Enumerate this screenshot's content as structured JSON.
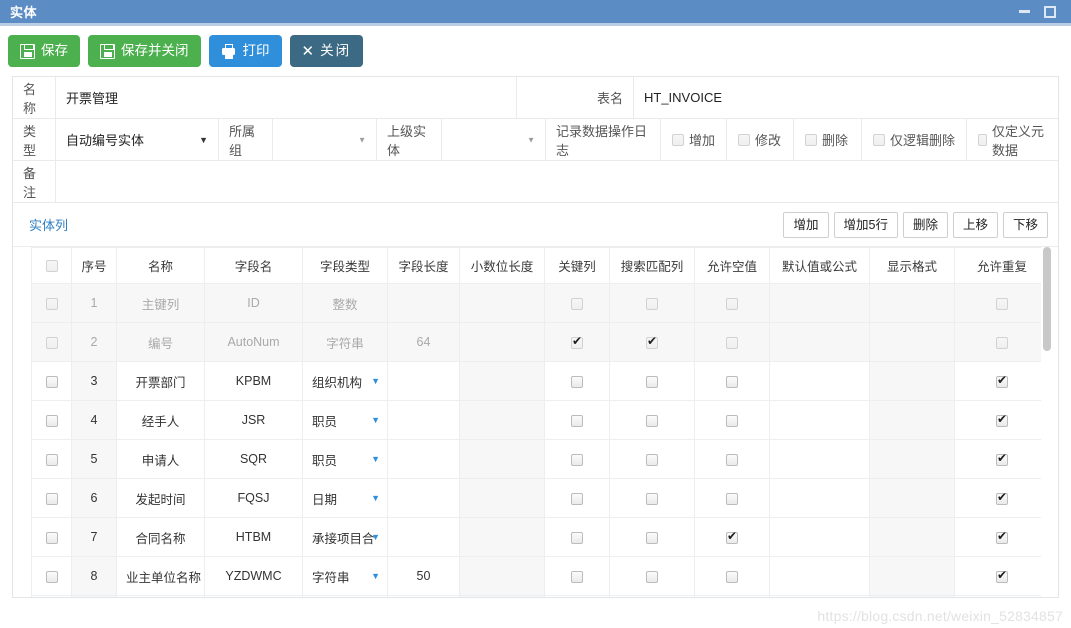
{
  "window": {
    "title": "实体",
    "minimize_label": "minimize",
    "maximize_label": "maximize",
    "accent_color": "#5b8cc4"
  },
  "toolbar": {
    "buttons": [
      {
        "label": "保存",
        "icon": "save-icon",
        "color": "#4cb04f"
      },
      {
        "label": "保存并关闭",
        "icon": "save-icon",
        "color": "#4cb04f"
      },
      {
        "label": "打印",
        "icon": "print-icon",
        "color": "#2f8fdb"
      },
      {
        "label": "关闭",
        "icon": "close-x-icon",
        "color": "#3c6a84"
      }
    ]
  },
  "form": {
    "name_label": "名称",
    "name_value": "开票管理",
    "table_label": "表名",
    "table_value": "HT_INVOICE",
    "type_label": "类型",
    "type_value": "自动编号实体",
    "group_label": "所属组",
    "group_value": "",
    "parent_label": "上级实体",
    "parent_value": "",
    "log_label": "记录数据操作日志",
    "log_options": [
      {
        "label": "增加",
        "checked": false
      },
      {
        "label": "修改",
        "checked": false
      },
      {
        "label": "删除",
        "checked": false
      },
      {
        "label": "仅逻辑删除",
        "checked": false
      },
      {
        "label": "仅定义元数据",
        "checked": false
      }
    ],
    "remark_label": "备注",
    "remark_value": ""
  },
  "grid": {
    "section_title": "实体列",
    "buttons": [
      "增加",
      "增加5行",
      "删除",
      "上移",
      "下移"
    ],
    "columns": [
      "",
      "序号",
      "名称",
      "字段名",
      "字段类型",
      "字段长度",
      "小数位长度",
      "关键列",
      "搜索匹配列",
      "允许空值",
      "默认值或公式",
      "显示格式",
      "允许重复"
    ],
    "rows": [
      {
        "seq": "1",
        "name": "主键列",
        "field": "ID",
        "type": "整数",
        "type_dropdown": false,
        "length": "",
        "decimals": "",
        "key": false,
        "search": false,
        "nullable": false,
        "default": "",
        "format": "",
        "duplicate": false,
        "disabled": true
      },
      {
        "seq": "2",
        "name": "编号",
        "field": "AutoNum",
        "type": "字符串",
        "type_dropdown": false,
        "length": "64",
        "decimals": "",
        "key": true,
        "search": true,
        "nullable": false,
        "default": "",
        "format": "",
        "duplicate": false,
        "disabled": true
      },
      {
        "seq": "3",
        "name": "开票部门",
        "field": "KPBM",
        "type": "组织机构",
        "type_dropdown": true,
        "length": "",
        "decimals": "",
        "key": false,
        "search": false,
        "nullable": false,
        "default": "",
        "format": "",
        "duplicate": true,
        "disabled": false
      },
      {
        "seq": "4",
        "name": "经手人",
        "field": "JSR",
        "type": "职员",
        "type_dropdown": true,
        "length": "",
        "decimals": "",
        "key": false,
        "search": false,
        "nullable": false,
        "default": "",
        "format": "",
        "duplicate": true,
        "disabled": false
      },
      {
        "seq": "5",
        "name": "申请人",
        "field": "SQR",
        "type": "职员",
        "type_dropdown": true,
        "length": "",
        "decimals": "",
        "key": false,
        "search": false,
        "nullable": false,
        "default": "",
        "format": "",
        "duplicate": true,
        "disabled": false
      },
      {
        "seq": "6",
        "name": "发起时间",
        "field": "FQSJ",
        "type": "日期",
        "type_dropdown": true,
        "length": "",
        "decimals": "",
        "key": false,
        "search": false,
        "nullable": false,
        "default": "",
        "format": "",
        "duplicate": true,
        "disabled": false
      },
      {
        "seq": "7",
        "name": "合同名称",
        "field": "HTBM",
        "type": "承接项目合",
        "type_dropdown": true,
        "length": "",
        "decimals": "",
        "key": false,
        "search": false,
        "nullable": true,
        "default": "",
        "format": "",
        "duplicate": true,
        "disabled": false
      },
      {
        "seq": "8",
        "name": "业主单位名称",
        "field": "YZDWMC",
        "type": "字符串",
        "type_dropdown": true,
        "length": "50",
        "decimals": "",
        "key": false,
        "search": false,
        "nullable": false,
        "default": "",
        "format": "",
        "duplicate": true,
        "disabled": false
      },
      {
        "seq": "",
        "name": "",
        "field": "",
        "type": "",
        "type_dropdown": false,
        "length": "",
        "decimals": "",
        "key": false,
        "search": false,
        "nullable": false,
        "default": "",
        "format": "",
        "duplicate": false,
        "disabled": false
      }
    ]
  },
  "watermark": "https://blog.csdn.net/weixin_52834857"
}
